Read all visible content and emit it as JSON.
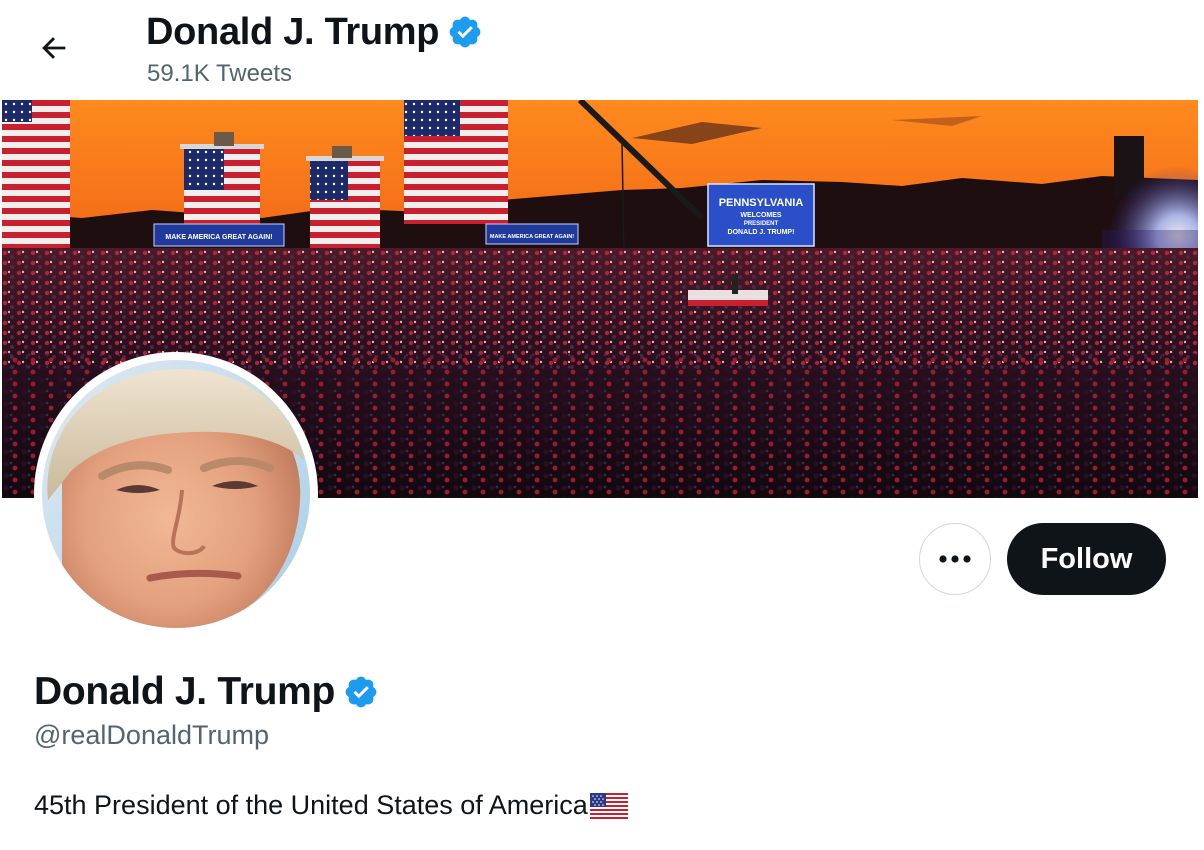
{
  "header": {
    "back_icon": "arrow-left-icon",
    "name": "Donald J. Trump",
    "tweet_count": "59.1K Tweets"
  },
  "banner": {
    "signs": {
      "sign_left": "MAKE AMERICA GREAT AGAIN!",
      "sign_mid": "MAKE AMERICA GREAT AGAIN!",
      "billboard_line1": "PENNSYLVANIA",
      "billboard_line2": "WELCOMES",
      "billboard_line3": "PRESIDENT",
      "billboard_line4": "DONALD J. TRUMP!"
    }
  },
  "actions": {
    "more_icon": "more-dots-icon",
    "follow_label": "Follow"
  },
  "profile": {
    "name": "Donald J. Trump",
    "handle": "@realDonaldTrump",
    "bio": "45th President of the United States of America",
    "bio_flag": "us-flag-icon"
  },
  "colors": {
    "verified": "#1d9bf0",
    "text_primary": "#0f1419",
    "text_secondary": "#536471",
    "follow_bg": "#0f1419",
    "border": "#cfd9de"
  }
}
